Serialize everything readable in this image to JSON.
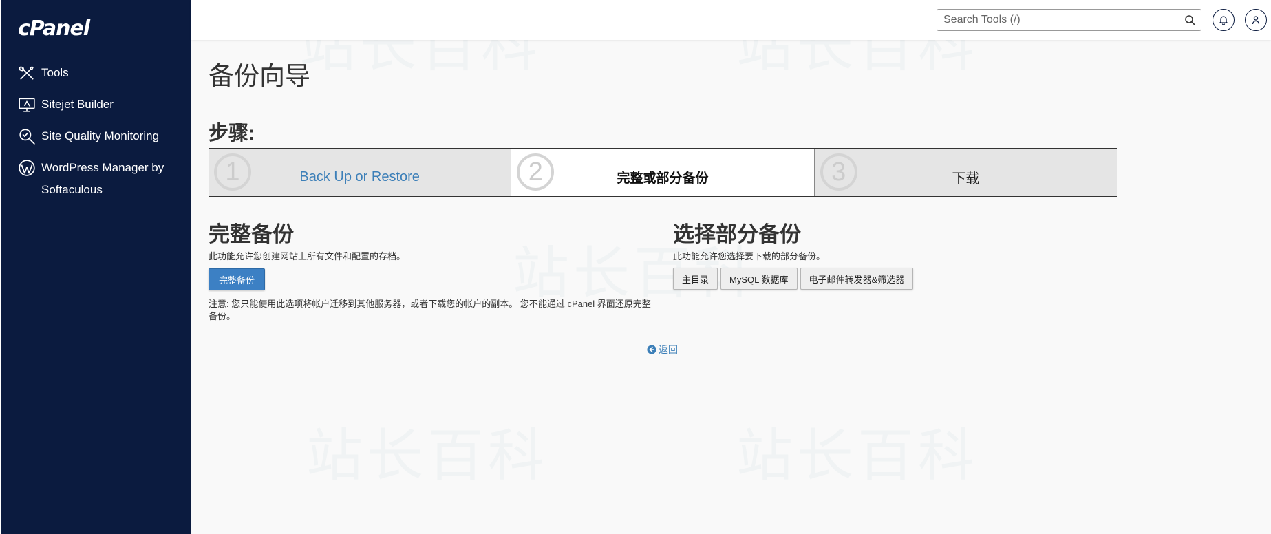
{
  "sidebar": {
    "logo": "cPanel",
    "items": [
      {
        "label": "Tools",
        "icon": "tools-icon"
      },
      {
        "label": "Sitejet Builder",
        "icon": "monitor-icon"
      },
      {
        "label": "Site Quality Monitoring",
        "icon": "magnifier-icon"
      },
      {
        "label": "WordPress Manager by Softaculous",
        "icon": "wordpress-icon"
      }
    ]
  },
  "header": {
    "search_placeholder": "Search Tools (/)"
  },
  "watermark": "站长百科",
  "main": {
    "title": "备份向导",
    "steps_title": "步骤:",
    "steps": [
      {
        "num": "1",
        "label": "Back Up or Restore",
        "state": "link"
      },
      {
        "num": "2",
        "label": "完整或部分备份",
        "state": "active"
      },
      {
        "num": "3",
        "label": "下载",
        "state": "inactive"
      }
    ],
    "full_backup": {
      "title": "完整备份",
      "desc": "此功能允许您创建网站上所有文件和配置的存档。",
      "button": "完整备份",
      "note": "注意: 您只能使用此选项将帐户迁移到其他服务器，或者下载您的帐户的副本。 您不能通过 cPanel 界面还原完整备份。"
    },
    "partial_backup": {
      "title": "选择部分备份",
      "desc": "此功能允许您选择要下载的部分备份。",
      "buttons": [
        "主目录",
        "MySQL 数据库",
        "电子邮件转发器&筛选器"
      ]
    },
    "back_link": "返回"
  },
  "colors": {
    "sidebar_bg": "#0b1b3f",
    "primary": "#3c80c4",
    "link": "#3c7fb8"
  }
}
